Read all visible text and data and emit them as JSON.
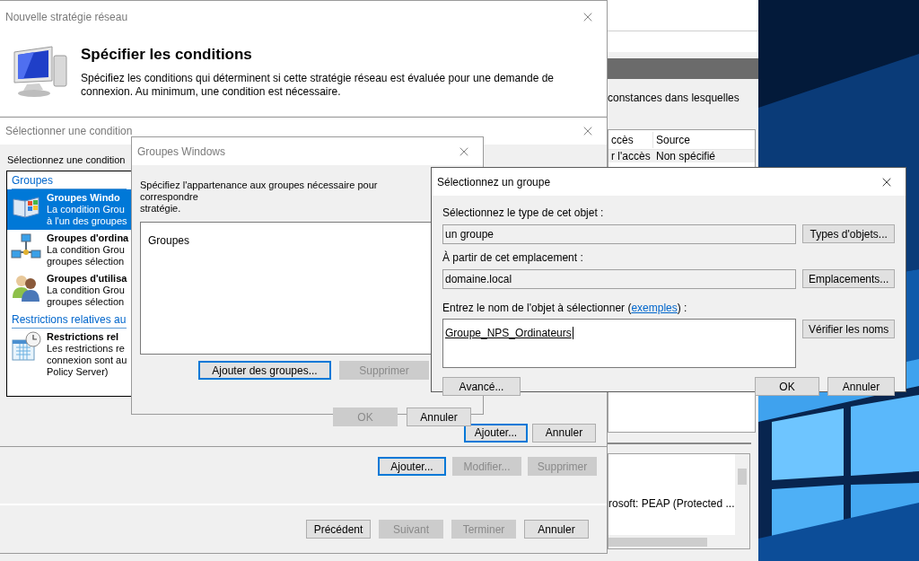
{
  "background_window": {
    "description_fragment": "constances dans lesquelles",
    "columns": [
      "ccès",
      "Source"
    ],
    "rows": [
      [
        "r l'accès",
        "Non spécifié"
      ]
    ],
    "details_text": "rosoft: PEAP (Protected ..."
  },
  "wizard": {
    "title": "Nouvelle stratégie réseau",
    "heading": "Spécifier les conditions",
    "description": "Spécifiez les conditions qui déterminent si cette stratégie réseau est évaluée pour une demande de connexion. Au minimum, une condition est nécessaire.",
    "condition_buttons": [
      {
        "label": "Ajouter...",
        "disabled": false,
        "focused": true
      },
      {
        "label": "Modifier...",
        "disabled": true,
        "focused": false
      },
      {
        "label": "Supprimer",
        "disabled": true,
        "focused": false
      }
    ],
    "nav_buttons": [
      {
        "label": "Précédent",
        "disabled": false,
        "focused": false
      },
      {
        "label": "Suivant",
        "disabled": true,
        "focused": false
      },
      {
        "label": "Terminer",
        "disabled": true,
        "focused": false
      },
      {
        "label": "Annuler",
        "disabled": false,
        "focused": false
      }
    ]
  },
  "select_condition": {
    "title": "Sélectionner une condition",
    "prompt": "Sélectionnez une condition",
    "items": [
      {
        "kind": "section",
        "label": "Groupes"
      },
      {
        "kind": "condition",
        "title": "Groupes Windo",
        "lines": [
          "La condition Grou",
          "à l'un des groupes"
        ],
        "selected": true
      },
      {
        "kind": "condition",
        "title": "Groupes d'ordina",
        "lines": [
          "La condition Grou",
          "groupes sélection"
        ],
        "selected": false
      },
      {
        "kind": "condition",
        "title": "Groupes d'utilisa",
        "lines": [
          "La condition Grou",
          "groupes sélection"
        ],
        "selected": false
      },
      {
        "kind": "section",
        "label": "Restrictions relatives au"
      },
      {
        "kind": "condition",
        "title": "Restrictions rel",
        "lines": [
          "Les restrictions re",
          "connexion sont au",
          "Policy Server)"
        ],
        "selected": false
      }
    ],
    "buttons": [
      {
        "label": "Ajouter...",
        "disabled": false,
        "focused": true
      },
      {
        "label": "Annuler",
        "disabled": false,
        "focused": false
      }
    ]
  },
  "groups_dialog": {
    "title": "Groupes Windows",
    "description_lines": [
      "Spécifiez l'appartenance aux groupes nécessaire pour correspondre",
      "stratégie."
    ],
    "list_header": "Groupes",
    "list_buttons": [
      {
        "label": "Ajouter des groupes...",
        "disabled": false,
        "focused": true
      },
      {
        "label": "Supprimer",
        "disabled": true,
        "focused": false
      }
    ],
    "buttons": [
      {
        "label": "OK",
        "disabled": true,
        "focused": false
      },
      {
        "label": "Annuler",
        "disabled": false,
        "focused": false
      }
    ]
  },
  "select_group": {
    "title": "Sélectionnez un groupe",
    "object_type": {
      "label": "Sélectionnez le type de cet objet :",
      "value": "un groupe",
      "button": "Types d'objets..."
    },
    "location": {
      "label": "À partir de cet emplacement :",
      "value": "domaine.local",
      "button": "Emplacements..."
    },
    "name_entry": {
      "label_before": "Entrez le nom de l'objet à sélectionner (",
      "link": "exemples",
      "label_after": ") :",
      "value": "Groupe_NPS_Ordinateurs",
      "button": "Vérifier les noms"
    },
    "buttons": [
      {
        "label": "Avancé...",
        "disabled": false,
        "focused": false
      },
      {
        "label": "OK",
        "disabled": false,
        "focused": false
      },
      {
        "label": "Annuler",
        "disabled": false,
        "focused": false
      }
    ]
  }
}
